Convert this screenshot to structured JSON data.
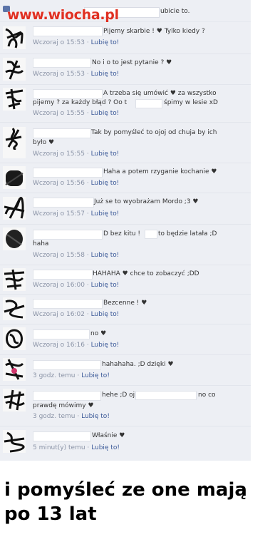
{
  "watermark": "www.wiocha.pl",
  "top": {
    "text": "ubicie to."
  },
  "like_label": "Lubię to!",
  "comments": [
    {
      "lines": [
        "Pijemy skarbie ! ♥ Tylko kiedy ?"
      ],
      "time": "Wczoraj o 15:53"
    },
    {
      "lines": [
        "No i o to jest pytanie ? ♥"
      ],
      "time": "Wczoraj o 15:53"
    },
    {
      "lines": [
        "A trzeba się umówić ♥ za wszystko",
        "pijemy ? za każdy błąd ? Oo t",
        "śpimy w lesie xD"
      ],
      "time": "Wczoraj o 15:55"
    },
    {
      "lines": [
        "Tak by pomyśleć to ojoj od chuja by ich",
        "było ♥"
      ],
      "time": "Wczoraj o 15:55"
    },
    {
      "lines": [
        "Haha a potem rzyganie kochanie ♥"
      ],
      "time": "Wczoraj o 15:56"
    },
    {
      "lines": [
        "Już se to wyobrażam Mordo ;3 ♥"
      ],
      "time": "Wczoraj o 15:57"
    },
    {
      "lines": [
        "D bez kitu !",
        "to będzie latała ;D",
        "haha"
      ],
      "time": "Wczoraj o 15:58"
    },
    {
      "lines": [
        "HAHAHA ♥ chce to zobaczyć ;DD"
      ],
      "time": "Wczoraj o 16:00"
    },
    {
      "lines": [
        "Bezcenne ! ♥"
      ],
      "time": "Wczoraj o 16:02"
    },
    {
      "lines": [
        "no ♥"
      ],
      "time": "Wczoraj o 16:16"
    },
    {
      "lines": [
        "hahahaha. ;D dzięki ♥"
      ],
      "time": "3 godz. temu"
    },
    {
      "lines": [
        "hehe ;D oj",
        "no co",
        "prawdę mówimy ♥"
      ],
      "time": "3 godz. temu"
    },
    {
      "lines": [
        "Właśnie ♥"
      ],
      "time": "5 minut(y) temu"
    }
  ],
  "caption": "i pomyśleć ze one mają po 13 lat"
}
